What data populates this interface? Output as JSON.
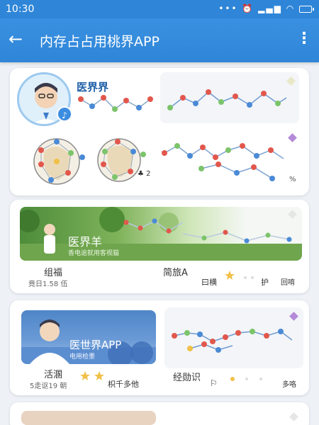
{
  "status_bar": {
    "time": "10:30",
    "icons": [
      "dots-icon",
      "alarm-icon",
      "data-icon",
      "signal-icon",
      "wifi-icon",
      "battery-icon"
    ]
  },
  "app_bar": {
    "title": "内存占占用桃界APP",
    "back_icon": "arrow-left-icon",
    "menu_icon": "more-vert-icon"
  },
  "card1": {
    "name": "医界界",
    "badge_label": "2",
    "percent": "%",
    "accent_color": "#2f86d8"
  },
  "card2": {
    "banner_title": "医界羊",
    "banner_sub": "香电逾就用客视猫",
    "left_label": "组福",
    "left_sub": "竟日1.58 伍",
    "right_label": "简旅A",
    "right_label2": "曰横",
    "right_label3": "护",
    "right_label4": "回唷"
  },
  "card3": {
    "banner_title": "医世界APP",
    "banner_sub": "电用检墨",
    "left_label": "活溷",
    "left_sub": "5走讴19 朝",
    "mid_label": "枳千多他",
    "right_label": "经勋识",
    "right_label2": "多咯"
  }
}
